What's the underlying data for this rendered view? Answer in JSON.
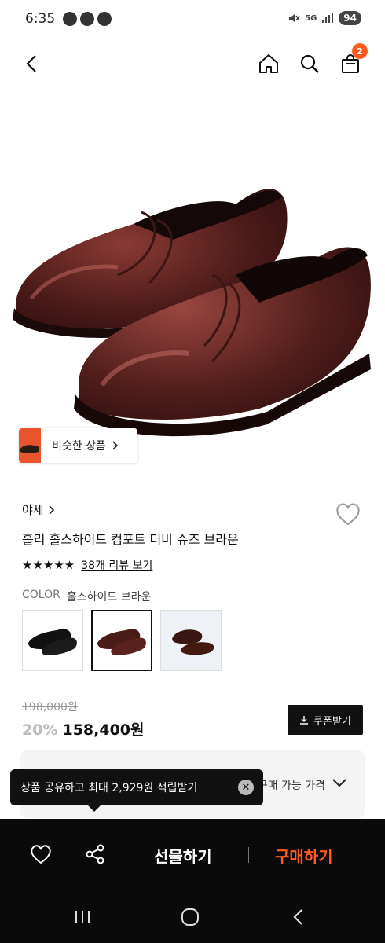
{
  "status_bar": {
    "time": "6:35",
    "network": "5G",
    "battery": "94"
  },
  "cart": {
    "badge_count": "2"
  },
  "similar": {
    "label": "비슷한 상품"
  },
  "product": {
    "brand": "야세",
    "name": "홀리 홀스하이드 컴포트 더비 슈즈 브라운",
    "rating_stars": 5,
    "review_link": "38개 리뷰 보기",
    "color_label": "COLOR",
    "color_value": "홀스하이드 브라운",
    "swatches": [
      "black",
      "brown",
      "dark-brown"
    ],
    "original_price": "198,000원",
    "discount": "20%",
    "sale_price": "158,400원",
    "coupon_label": "쿠폰받기"
  },
  "price_box": {
    "label": "구매 가능 가격"
  },
  "toast": {
    "message": "상품 공유하고 최대 2,929원 적립받기"
  },
  "action_bar": {
    "gift_label": "선물하기",
    "buy_label": "구매하기",
    "buy_color": "#ff5a1f"
  }
}
